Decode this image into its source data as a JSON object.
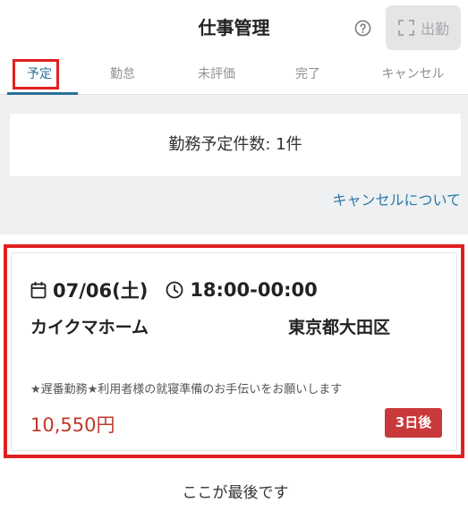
{
  "header": {
    "title": "仕事管理",
    "help_icon": "question-circle-icon",
    "checkin_button": {
      "label": "出勤",
      "icon": "scan-frame-icon"
    }
  },
  "tabs": [
    {
      "label": "予定",
      "active": true
    },
    {
      "label": "勤怠",
      "active": false
    },
    {
      "label": "未評価",
      "active": false
    },
    {
      "label": "完了",
      "active": false
    },
    {
      "label": "キャンセル",
      "active": false
    }
  ],
  "summary": {
    "count_text": "勤務予定件数: 1件"
  },
  "cancel_link": "キャンセルについて",
  "job": {
    "date": "07/06(土)",
    "time": "18:00-00:00",
    "client": "カイクマホーム",
    "area": "東京都大田区",
    "description": "★遅番勤務★利用者様の就寝準備のお手伝いをお願いします",
    "wage": "10,550円",
    "days_until": "3日後"
  },
  "end_message": "ここが最後です",
  "colors": {
    "accent": "#2a6f9a",
    "link": "#2a7aa8",
    "wage": "#c0392b",
    "badge": "#c9383a",
    "highlight": "#e02020"
  }
}
